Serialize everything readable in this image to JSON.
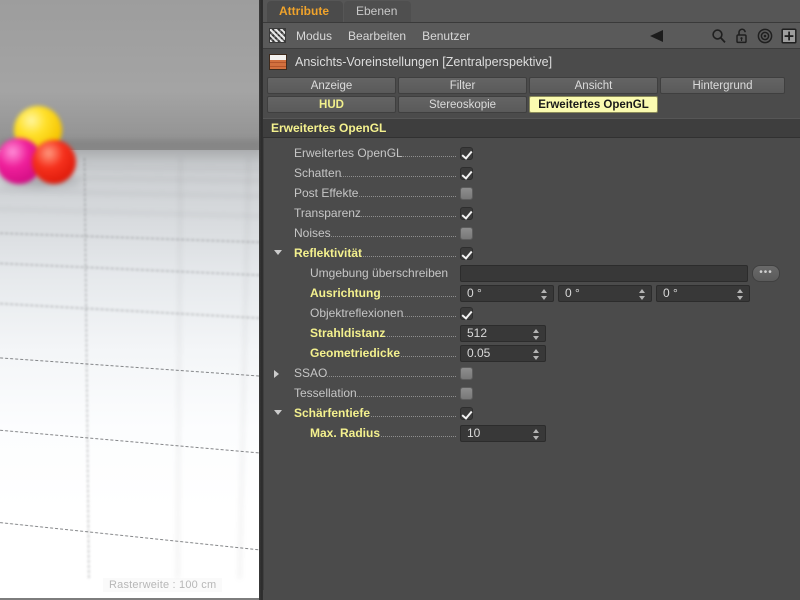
{
  "viewport": {
    "hud_label": "Rasterweite : 100 cm",
    "spheres": [
      {
        "name": "sphere-yellow",
        "color": "#ffe02a"
      },
      {
        "name": "sphere-magenta",
        "color": "#ef1f9a"
      },
      {
        "name": "sphere-red",
        "color": "#f6311d"
      }
    ]
  },
  "panel": {
    "tabs": [
      {
        "label": "Attribute",
        "active": true
      },
      {
        "label": "Ebenen",
        "active": false
      }
    ],
    "menu": [
      "Modus",
      "Bearbeiten",
      "Benutzer"
    ],
    "menu_icons": [
      "checker-icon",
      "back-arrow-icon",
      "search-icon",
      "lock-open-icon",
      "target-icon",
      "plus-box-icon"
    ],
    "object_title": "Ansichts-Voreinstellungen [Zentralperspektive]",
    "object_icon": "viewport-settings-icon",
    "pagetabs_row1": [
      {
        "label": "Anzeige",
        "style": "normal"
      },
      {
        "label": "Filter",
        "style": "normal"
      },
      {
        "label": "Ansicht",
        "style": "normal"
      },
      {
        "label": "Hintergrund",
        "style": "normal"
      }
    ],
    "pagetabs_row2": [
      {
        "label": "HUD",
        "style": "yellowtext"
      },
      {
        "label": "Stereoskopie",
        "style": "normal"
      },
      {
        "label": "Erweitertes OpenGL",
        "style": "active"
      }
    ],
    "group_header": "Erweitertes OpenGL",
    "rows": [
      {
        "label": "Erweitertes OpenGL",
        "indent": 28,
        "type": "checkbox",
        "checked": true,
        "yellow": false,
        "twisty": "none"
      },
      {
        "label": "Schatten",
        "indent": 28,
        "type": "checkbox",
        "checked": true,
        "yellow": false,
        "twisty": "none"
      },
      {
        "label": "Post Effekte",
        "indent": 28,
        "type": "checkbox",
        "checked": false,
        "yellow": false,
        "twisty": "none"
      },
      {
        "label": "Transparenz",
        "indent": 28,
        "type": "checkbox",
        "checked": true,
        "yellow": false,
        "twisty": "none"
      },
      {
        "label": "Noises",
        "indent": 28,
        "type": "checkbox",
        "checked": false,
        "yellow": false,
        "twisty": "none"
      },
      {
        "label": "Reflektivität",
        "indent": 28,
        "type": "checkbox",
        "checked": true,
        "yellow": true,
        "twisty": "down"
      },
      {
        "label": "Umgebung überschreiben",
        "indent": 44,
        "type": "textfield-dots",
        "value": "",
        "yellow": false,
        "twisty": "none"
      },
      {
        "label": "Ausrichtung",
        "indent": 44,
        "type": "triple-number",
        "values": [
          "0 °",
          "0 °",
          "0 °"
        ],
        "yellow": true,
        "twisty": "none"
      },
      {
        "label": "Objektreflexionen",
        "indent": 44,
        "type": "checkbox",
        "checked": true,
        "yellow": false,
        "twisty": "none"
      },
      {
        "label": "Strahldistanz",
        "indent": 44,
        "type": "number",
        "value": "512",
        "yellow": true,
        "twisty": "none"
      },
      {
        "label": "Geometriedicke",
        "indent": 44,
        "type": "number",
        "value": "0.05",
        "yellow": true,
        "twisty": "none"
      },
      {
        "label": "SSAO",
        "indent": 28,
        "type": "checkbox",
        "checked": false,
        "yellow": false,
        "twisty": "right"
      },
      {
        "label": "Tessellation",
        "indent": 28,
        "type": "checkbox",
        "checked": false,
        "yellow": false,
        "twisty": "none"
      },
      {
        "label": "Schärfentiefe",
        "indent": 28,
        "type": "checkbox",
        "checked": true,
        "yellow": true,
        "twisty": "down"
      },
      {
        "label": "Max. Radius",
        "indent": 44,
        "type": "number",
        "value": "10",
        "yellow": true,
        "twisty": "none"
      }
    ]
  },
  "colors": {
    "panel_bg": "#4b4b4b",
    "accent_yellow": "#f4f18e",
    "tab_orange": "#f0a32b",
    "active_tab_bg": "#fbfbb0"
  }
}
